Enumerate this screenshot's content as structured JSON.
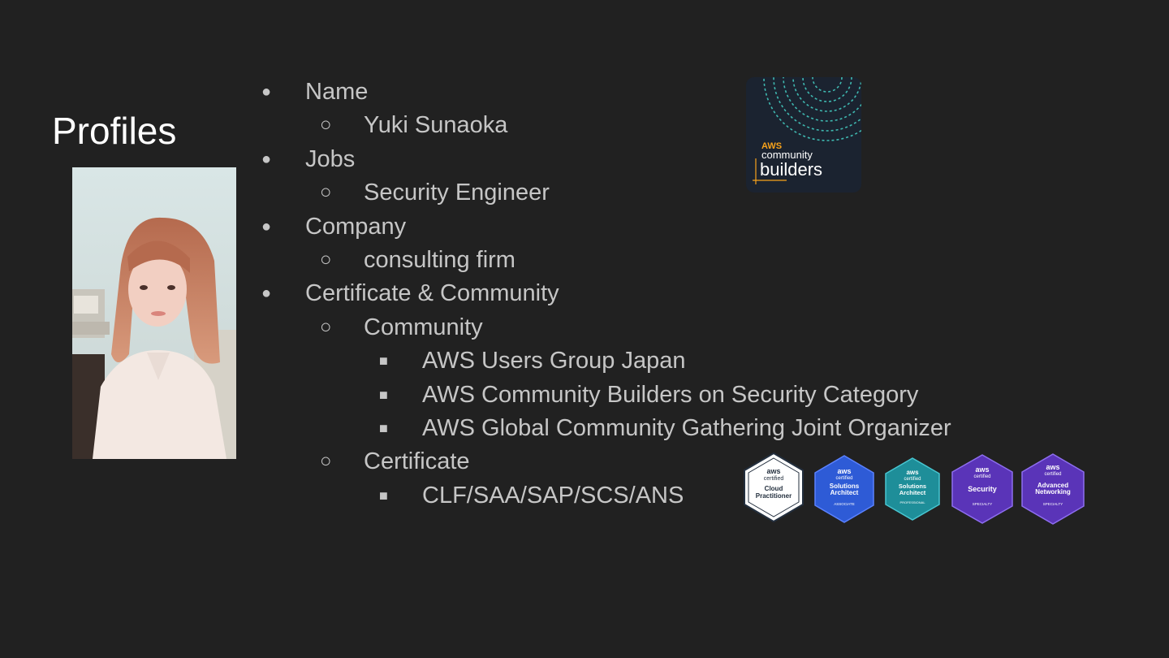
{
  "slide": {
    "title": "Profiles",
    "items": [
      {
        "level": 1,
        "text": "Name"
      },
      {
        "level": 2,
        "text": "Yuki Sunaoka"
      },
      {
        "level": 1,
        "text": "Jobs"
      },
      {
        "level": 2,
        "text": "Security Engineer"
      },
      {
        "level": 1,
        "text": "Company"
      },
      {
        "level": 2,
        "text": "consulting firm"
      },
      {
        "level": 1,
        "text": "Certificate & Community"
      },
      {
        "level": 2,
        "text": "Community"
      },
      {
        "level": 3,
        "text": "AWS Users Group Japan"
      },
      {
        "level": 3,
        "text": "AWS Community Builders on Security Category"
      },
      {
        "level": 3,
        "text": "AWS Global Community Gathering Joint Organizer"
      },
      {
        "level": 2,
        "text": "Certificate"
      },
      {
        "level": 3,
        "text": "CLF/SAA/SAP/SCS/ANS"
      }
    ],
    "bullets": {
      "level1": "●",
      "level2": "○",
      "level3": "■"
    }
  },
  "logo": {
    "line1": "AWS",
    "line2": "community",
    "line3": "builders",
    "accent_color": "#f7a21b",
    "arc_color": "#3fb8b0",
    "bg_color": "#1b2330"
  },
  "badges": [
    {
      "brand": "aws",
      "sub": "certified",
      "name1": "Cloud",
      "name2": "Practitioner",
      "level": "",
      "color": "#ffffff",
      "text_color": "#232f3e"
    },
    {
      "brand": "aws",
      "sub": "certified",
      "name1": "Solutions",
      "name2": "Architect",
      "level": "ASSOCIATE",
      "color": "#2e5bd6",
      "text_color": "#ffffff"
    },
    {
      "brand": "aws",
      "sub": "certified",
      "name1": "Solutions",
      "name2": "Architect",
      "level": "PROFESSIONAL",
      "color": "#1e8e99",
      "text_color": "#ffffff"
    },
    {
      "brand": "aws",
      "sub": "certified",
      "name1": "Security",
      "name2": "",
      "level": "SPECIALTY",
      "color": "#5a34b8",
      "text_color": "#ffffff"
    },
    {
      "brand": "aws",
      "sub": "certified",
      "name1": "Advanced",
      "name2": "Networking",
      "level": "SPECIALTY",
      "color": "#5a34b8",
      "text_color": "#ffffff"
    }
  ]
}
